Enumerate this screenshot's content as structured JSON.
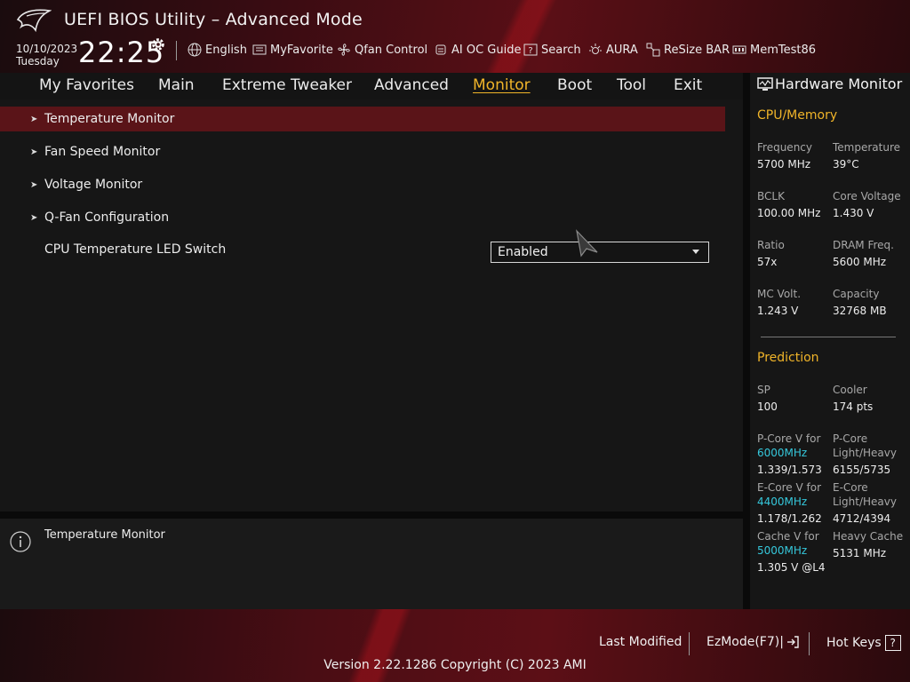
{
  "header": {
    "title": "UEFI BIOS Utility – Advanced Mode",
    "date": "10/10/2023",
    "day": "Tuesday",
    "time": "22:25",
    "buttons": [
      {
        "label": "English",
        "icon": "globe-icon"
      },
      {
        "label": "MyFavorite",
        "icon": "favorite-list-icon"
      },
      {
        "label": "Qfan Control",
        "icon": "fan-icon"
      },
      {
        "label": "AI OC Guide",
        "icon": "ai-chip-icon"
      },
      {
        "label": "Search",
        "icon": "search-help-icon"
      },
      {
        "label": "AURA",
        "icon": "aura-light-icon"
      },
      {
        "label": "ReSize BAR",
        "icon": "resize-bar-icon"
      },
      {
        "label": "MemTest86",
        "icon": "memory-icon"
      }
    ]
  },
  "nav": {
    "tabs": [
      "My Favorites",
      "Main",
      "Extreme Tweaker",
      "Advanced",
      "Monitor",
      "Boot",
      "Tool",
      "Exit"
    ],
    "active": "Monitor"
  },
  "main": {
    "items": [
      "Temperature Monitor",
      "Fan Speed Monitor",
      "Voltage Monitor",
      "Q-Fan Configuration"
    ],
    "setting": {
      "label": "CPU Temperature LED Switch",
      "value": "Enabled"
    }
  },
  "info": {
    "text": "Temperature Monitor"
  },
  "hardware_monitor": {
    "title": "Hardware Monitor",
    "cpu_memory": {
      "heading": "CPU/Memory",
      "rows": [
        {
          "l1": "Frequency",
          "v1": "5700 MHz",
          "l2": "Temperature",
          "v2": "39°C"
        },
        {
          "l1": "BCLK",
          "v1": "100.00 MHz",
          "l2": "Core Voltage",
          "v2": "1.430 V"
        },
        {
          "l1": "Ratio",
          "v1": "57x",
          "l2": "DRAM Freq.",
          "v2": "5600 MHz"
        },
        {
          "l1": "MC Volt.",
          "v1": "1.243 V",
          "l2": "Capacity",
          "v2": "32768 MB"
        }
      ]
    },
    "prediction": {
      "heading": "Prediction",
      "sp_label": "SP",
      "sp_value": "100",
      "cooler_label": "Cooler",
      "cooler_value": "174 pts",
      "pcore_v_label": "P-Core V for",
      "pcore_v_freq": "6000MHz",
      "pcore_v_value": "1.339/1.573",
      "pcore_lh_label1": "P-Core",
      "pcore_lh_label2": "Light/Heavy",
      "pcore_lh_value": "6155/5735",
      "ecore_v_label": "E-Core V for",
      "ecore_v_freq": "4400MHz",
      "ecore_v_value": "1.178/1.262",
      "ecore_lh_label1": "E-Core",
      "ecore_lh_label2": "Light/Heavy",
      "ecore_lh_value": "4712/4394",
      "cache_v_label": "Cache V for",
      "cache_v_freq": "5000MHz",
      "cache_v_value": "1.305 V @L4",
      "heavy_cache_label": "Heavy Cache",
      "heavy_cache_value": "5131 MHz"
    }
  },
  "footer": {
    "last_modified": "Last Modified",
    "ezmode": "EzMode(F7)|",
    "hotkeys": "Hot Keys",
    "hotkeys_key": "?",
    "version": "Version 2.22.1286 Copyright (C) 2023 AMI"
  },
  "colors": {
    "accent": "#f0b429",
    "selection": "#5a1418",
    "cyan": "#35c8dc"
  }
}
